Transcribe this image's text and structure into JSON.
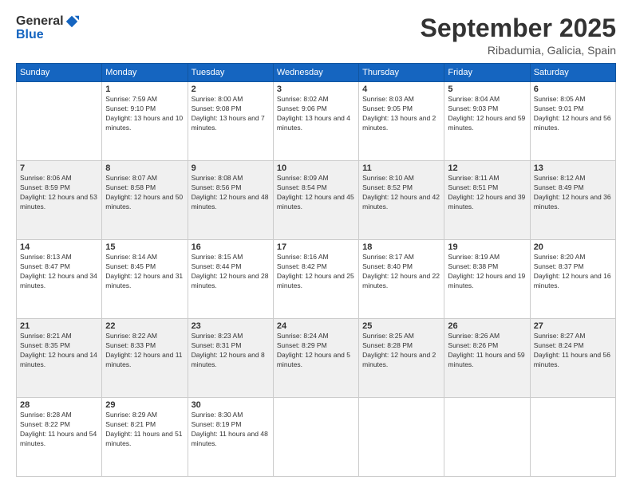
{
  "header": {
    "logo_general": "General",
    "logo_blue": "Blue",
    "month_title": "September 2025",
    "location": "Ribadumia, Galicia, Spain"
  },
  "days_of_week": [
    "Sunday",
    "Monday",
    "Tuesday",
    "Wednesday",
    "Thursday",
    "Friday",
    "Saturday"
  ],
  "weeks": [
    [
      {
        "day": "",
        "sunrise": "",
        "sunset": "",
        "daylight": ""
      },
      {
        "day": "1",
        "sunrise": "Sunrise: 7:59 AM",
        "sunset": "Sunset: 9:10 PM",
        "daylight": "Daylight: 13 hours and 10 minutes."
      },
      {
        "day": "2",
        "sunrise": "Sunrise: 8:00 AM",
        "sunset": "Sunset: 9:08 PM",
        "daylight": "Daylight: 13 hours and 7 minutes."
      },
      {
        "day": "3",
        "sunrise": "Sunrise: 8:02 AM",
        "sunset": "Sunset: 9:06 PM",
        "daylight": "Daylight: 13 hours and 4 minutes."
      },
      {
        "day": "4",
        "sunrise": "Sunrise: 8:03 AM",
        "sunset": "Sunset: 9:05 PM",
        "daylight": "Daylight: 13 hours and 2 minutes."
      },
      {
        "day": "5",
        "sunrise": "Sunrise: 8:04 AM",
        "sunset": "Sunset: 9:03 PM",
        "daylight": "Daylight: 12 hours and 59 minutes."
      },
      {
        "day": "6",
        "sunrise": "Sunrise: 8:05 AM",
        "sunset": "Sunset: 9:01 PM",
        "daylight": "Daylight: 12 hours and 56 minutes."
      }
    ],
    [
      {
        "day": "7",
        "sunrise": "Sunrise: 8:06 AM",
        "sunset": "Sunset: 8:59 PM",
        "daylight": "Daylight: 12 hours and 53 minutes."
      },
      {
        "day": "8",
        "sunrise": "Sunrise: 8:07 AM",
        "sunset": "Sunset: 8:58 PM",
        "daylight": "Daylight: 12 hours and 50 minutes."
      },
      {
        "day": "9",
        "sunrise": "Sunrise: 8:08 AM",
        "sunset": "Sunset: 8:56 PM",
        "daylight": "Daylight: 12 hours and 48 minutes."
      },
      {
        "day": "10",
        "sunrise": "Sunrise: 8:09 AM",
        "sunset": "Sunset: 8:54 PM",
        "daylight": "Daylight: 12 hours and 45 minutes."
      },
      {
        "day": "11",
        "sunrise": "Sunrise: 8:10 AM",
        "sunset": "Sunset: 8:52 PM",
        "daylight": "Daylight: 12 hours and 42 minutes."
      },
      {
        "day": "12",
        "sunrise": "Sunrise: 8:11 AM",
        "sunset": "Sunset: 8:51 PM",
        "daylight": "Daylight: 12 hours and 39 minutes."
      },
      {
        "day": "13",
        "sunrise": "Sunrise: 8:12 AM",
        "sunset": "Sunset: 8:49 PM",
        "daylight": "Daylight: 12 hours and 36 minutes."
      }
    ],
    [
      {
        "day": "14",
        "sunrise": "Sunrise: 8:13 AM",
        "sunset": "Sunset: 8:47 PM",
        "daylight": "Daylight: 12 hours and 34 minutes."
      },
      {
        "day": "15",
        "sunrise": "Sunrise: 8:14 AM",
        "sunset": "Sunset: 8:45 PM",
        "daylight": "Daylight: 12 hours and 31 minutes."
      },
      {
        "day": "16",
        "sunrise": "Sunrise: 8:15 AM",
        "sunset": "Sunset: 8:44 PM",
        "daylight": "Daylight: 12 hours and 28 minutes."
      },
      {
        "day": "17",
        "sunrise": "Sunrise: 8:16 AM",
        "sunset": "Sunset: 8:42 PM",
        "daylight": "Daylight: 12 hours and 25 minutes."
      },
      {
        "day": "18",
        "sunrise": "Sunrise: 8:17 AM",
        "sunset": "Sunset: 8:40 PM",
        "daylight": "Daylight: 12 hours and 22 minutes."
      },
      {
        "day": "19",
        "sunrise": "Sunrise: 8:19 AM",
        "sunset": "Sunset: 8:38 PM",
        "daylight": "Daylight: 12 hours and 19 minutes."
      },
      {
        "day": "20",
        "sunrise": "Sunrise: 8:20 AM",
        "sunset": "Sunset: 8:37 PM",
        "daylight": "Daylight: 12 hours and 16 minutes."
      }
    ],
    [
      {
        "day": "21",
        "sunrise": "Sunrise: 8:21 AM",
        "sunset": "Sunset: 8:35 PM",
        "daylight": "Daylight: 12 hours and 14 minutes."
      },
      {
        "day": "22",
        "sunrise": "Sunrise: 8:22 AM",
        "sunset": "Sunset: 8:33 PM",
        "daylight": "Daylight: 12 hours and 11 minutes."
      },
      {
        "day": "23",
        "sunrise": "Sunrise: 8:23 AM",
        "sunset": "Sunset: 8:31 PM",
        "daylight": "Daylight: 12 hours and 8 minutes."
      },
      {
        "day": "24",
        "sunrise": "Sunrise: 8:24 AM",
        "sunset": "Sunset: 8:29 PM",
        "daylight": "Daylight: 12 hours and 5 minutes."
      },
      {
        "day": "25",
        "sunrise": "Sunrise: 8:25 AM",
        "sunset": "Sunset: 8:28 PM",
        "daylight": "Daylight: 12 hours and 2 minutes."
      },
      {
        "day": "26",
        "sunrise": "Sunrise: 8:26 AM",
        "sunset": "Sunset: 8:26 PM",
        "daylight": "Daylight: 11 hours and 59 minutes."
      },
      {
        "day": "27",
        "sunrise": "Sunrise: 8:27 AM",
        "sunset": "Sunset: 8:24 PM",
        "daylight": "Daylight: 11 hours and 56 minutes."
      }
    ],
    [
      {
        "day": "28",
        "sunrise": "Sunrise: 8:28 AM",
        "sunset": "Sunset: 8:22 PM",
        "daylight": "Daylight: 11 hours and 54 minutes."
      },
      {
        "day": "29",
        "sunrise": "Sunrise: 8:29 AM",
        "sunset": "Sunset: 8:21 PM",
        "daylight": "Daylight: 11 hours and 51 minutes."
      },
      {
        "day": "30",
        "sunrise": "Sunrise: 8:30 AM",
        "sunset": "Sunset: 8:19 PM",
        "daylight": "Daylight: 11 hours and 48 minutes."
      },
      {
        "day": "",
        "sunrise": "",
        "sunset": "",
        "daylight": ""
      },
      {
        "day": "",
        "sunrise": "",
        "sunset": "",
        "daylight": ""
      },
      {
        "day": "",
        "sunrise": "",
        "sunset": "",
        "daylight": ""
      },
      {
        "day": "",
        "sunrise": "",
        "sunset": "",
        "daylight": ""
      }
    ]
  ]
}
